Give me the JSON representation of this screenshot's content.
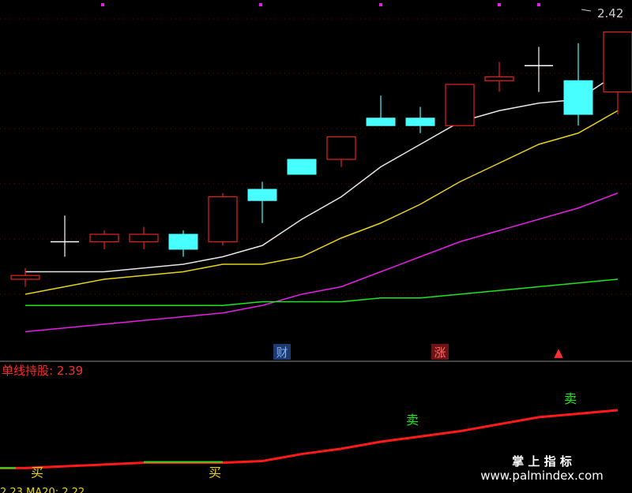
{
  "chart_data": [
    {
      "type": "candlestick",
      "price_label": "2.42",
      "ylim": [
        1.6,
        2.48
      ],
      "candles": [
        {
          "x": 0,
          "o": 1.76,
          "h": 1.79,
          "l": 1.74,
          "c": 1.77
        },
        {
          "x": 1,
          "o": 1.86,
          "h": 1.93,
          "l": 1.82,
          "c": 1.86
        },
        {
          "x": 2,
          "o": 1.86,
          "h": 1.89,
          "l": 1.84,
          "c": 1.88
        },
        {
          "x": 3,
          "o": 1.86,
          "h": 1.9,
          "l": 1.84,
          "c": 1.88
        },
        {
          "x": 4,
          "o": 1.88,
          "h": 1.89,
          "l": 1.82,
          "c": 1.84
        },
        {
          "x": 5,
          "o": 1.86,
          "h": 1.99,
          "l": 1.85,
          "c": 1.98
        },
        {
          "x": 6,
          "o": 2.0,
          "h": 2.02,
          "l": 1.91,
          "c": 1.97
        },
        {
          "x": 7,
          "o": 2.08,
          "h": 2.08,
          "l": 2.04,
          "c": 2.04
        },
        {
          "x": 8,
          "o": 2.08,
          "h": 2.14,
          "l": 2.06,
          "c": 2.14
        },
        {
          "x": 9,
          "o": 2.19,
          "h": 2.25,
          "l": 2.17,
          "c": 2.17
        },
        {
          "x": 10,
          "o": 2.19,
          "h": 2.22,
          "l": 2.15,
          "c": 2.17
        },
        {
          "x": 11,
          "o": 2.17,
          "h": 2.28,
          "l": 2.17,
          "c": 2.28
        },
        {
          "x": 12,
          "o": 2.29,
          "h": 2.34,
          "l": 2.26,
          "c": 2.3
        },
        {
          "x": 13,
          "o": 2.33,
          "h": 2.38,
          "l": 2.26,
          "c": 2.33
        },
        {
          "x": 14,
          "o": 2.29,
          "h": 2.39,
          "l": 2.17,
          "c": 2.2
        },
        {
          "x": 15,
          "o": 2.26,
          "h": 2.42,
          "l": 2.2,
          "c": 2.42
        }
      ],
      "ma_lines": [
        {
          "color": "#e6e6e6",
          "values": [
            1.78,
            1.78,
            1.78,
            1.79,
            1.8,
            1.82,
            1.85,
            1.92,
            1.98,
            2.06,
            2.12,
            2.18,
            2.21,
            2.23,
            2.24,
            2.31
          ]
        },
        {
          "color": "#e6d21a",
          "values": [
            1.72,
            1.74,
            1.76,
            1.77,
            1.78,
            1.8,
            1.8,
            1.82,
            1.87,
            1.91,
            1.96,
            2.02,
            2.07,
            2.12,
            2.15,
            2.21
          ]
        },
        {
          "color": "#e61ee6",
          "values": [
            1.62,
            1.63,
            1.64,
            1.65,
            1.66,
            1.67,
            1.69,
            1.72,
            1.74,
            1.78,
            1.82,
            1.86,
            1.89,
            1.92,
            1.95,
            1.99
          ]
        },
        {
          "color": "#1ee61e",
          "values": [
            1.69,
            1.69,
            1.69,
            1.69,
            1.69,
            1.69,
            1.7,
            1.7,
            1.7,
            1.71,
            1.71,
            1.72,
            1.73,
            1.74,
            1.75,
            1.76
          ]
        }
      ],
      "event_markers": [
        {
          "x": 6.5,
          "text": "财",
          "color": "#7fb0ff",
          "bg": "#1b3a70"
        },
        {
          "x": 10.5,
          "text": "涨",
          "color": "#ff6a6a",
          "bg": "#6a1414"
        },
        {
          "x": 13.5,
          "text": "▲",
          "color": "#ff3030",
          "bg": "#000"
        }
      ]
    },
    {
      "type": "line",
      "title": "单线持股: 2.39",
      "ylim": [
        1.0,
        1.45
      ],
      "x": [
        0,
        1,
        2,
        3,
        4,
        5,
        6,
        7,
        8,
        9,
        10,
        11,
        12,
        13,
        14,
        15
      ],
      "values": [
        1.03,
        1.04,
        1.05,
        1.06,
        1.06,
        1.06,
        1.07,
        1.11,
        1.14,
        1.18,
        1.21,
        1.24,
        1.28,
        1.32,
        1.34,
        1.36
      ],
      "green_segment": [
        3,
        5
      ],
      "signals": [
        {
          "x": 0.3,
          "text": "买",
          "color": "#e6d21a",
          "y": 0.98
        },
        {
          "x": 4.8,
          "text": "买",
          "color": "#e6d21a",
          "y": 0.98
        },
        {
          "x": 9.8,
          "text": "卖",
          "color": "#1ee61e",
          "y": 1.28
        },
        {
          "x": 13.8,
          "text": "卖",
          "color": "#1ee61e",
          "y": 1.4
        }
      ]
    }
  ],
  "watermark": {
    "line1": "掌 上 指 标",
    "line2": "www.palmindex.com"
  },
  "bottom_legend": "2.23 MA20: 2.22"
}
